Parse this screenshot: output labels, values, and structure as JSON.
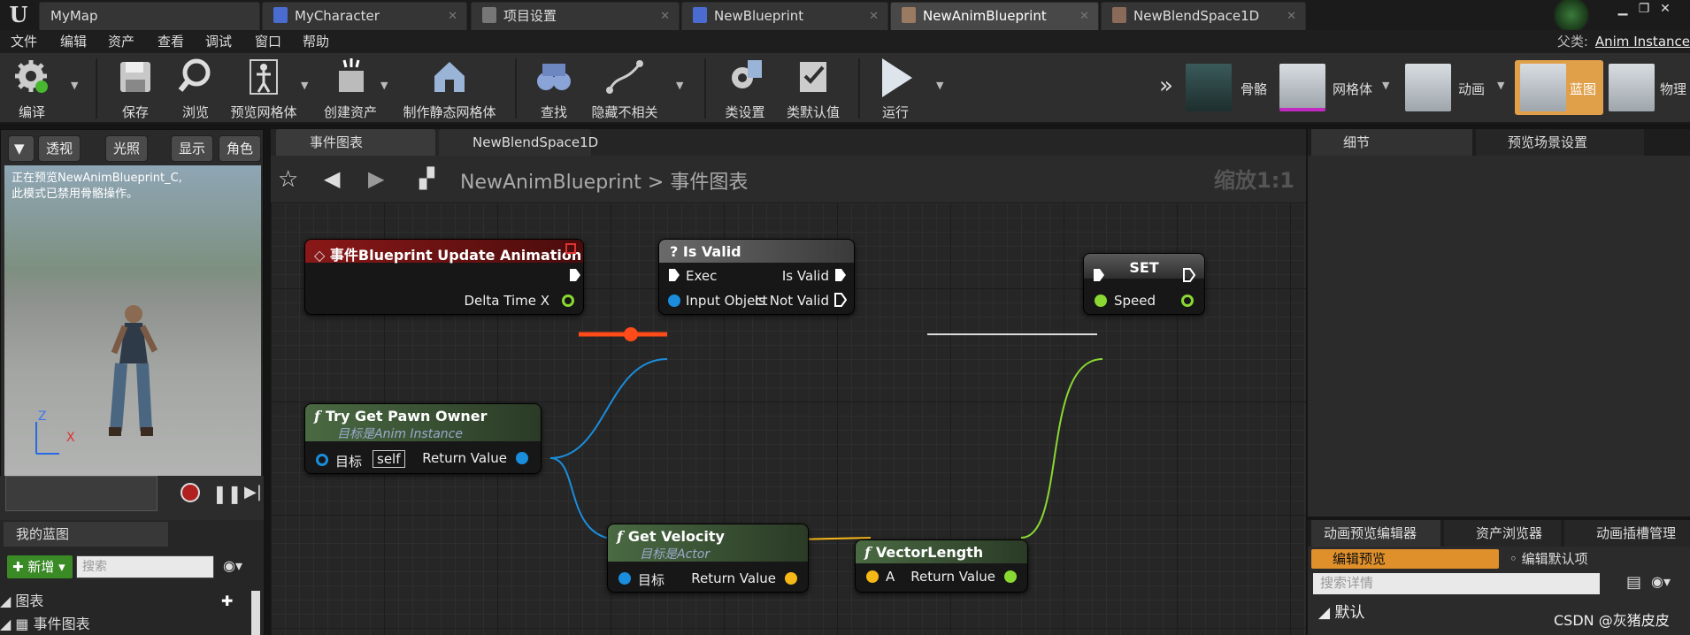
{
  "title_tabs": [
    {
      "label": "MyMap",
      "icon": "ue-logo-icon"
    },
    {
      "label": "MyCharacter",
      "icon": "blueprint-icon"
    },
    {
      "label": "项目设置",
      "icon": "gear-icon"
    },
    {
      "label": "NewBlueprint",
      "icon": "blueprint-icon"
    },
    {
      "label": "NewAnimBlueprint",
      "icon": "anim-blueprint-icon"
    },
    {
      "label": "NewBlendSpace1D",
      "icon": "blendspace-icon"
    }
  ],
  "active_tab": "NewAnimBlueprint",
  "menu": [
    "文件",
    "编辑",
    "资产",
    "查看",
    "调试",
    "窗口",
    "帮助"
  ],
  "parent_class": {
    "label": "父类:",
    "value": "Anim Instance"
  },
  "toolbar": {
    "compile": "编译",
    "save": "保存",
    "browse": "浏览",
    "preview_mesh": "预览网格体",
    "create_asset": "创建资产",
    "make_static_mesh": "制作静态网格体",
    "find": "查找",
    "hide_unrelated": "隐藏不相关",
    "class_settings": "类设置",
    "class_defaults": "类默认值",
    "play": "运行"
  },
  "modes": {
    "skeleton": "骨骼",
    "mesh": "网格体",
    "animation": "动画",
    "blueprint": "蓝图",
    "physics": "物理"
  },
  "viewport": {
    "buttons": {
      "perspective": "透视",
      "lit": "光照",
      "show": "显示",
      "character": "角色"
    },
    "info_line1": "正在预览NewAnimBlueprint_C,",
    "info_line2": "此模式已禁用骨骼操作。",
    "axis_z": "Z",
    "axis_x": "X"
  },
  "my_blueprint": {
    "tab": "我的蓝图",
    "new_button": "新增",
    "search_placeholder": "搜索",
    "tree": [
      {
        "label": "图表",
        "expanded": true
      },
      {
        "label": "事件图表",
        "expanded": true
      }
    ]
  },
  "graph": {
    "tabs": [
      "事件图表",
      "NewBlendSpace1D"
    ],
    "breadcrumb_root": "NewAnimBlueprint",
    "breadcrumb_sep": ">",
    "breadcrumb_leaf": "事件图表",
    "zoom": "缩放1:1",
    "nodes": {
      "event": {
        "title": "事件Blueprint Update Animation",
        "pin_delta": "Delta Time X"
      },
      "isvalid": {
        "title": "Is Valid",
        "pin_exec": "Exec",
        "pin_input": "Input Object",
        "pin_valid": "Is Valid",
        "pin_notvalid": "Is Not Valid"
      },
      "set": {
        "title": "SET",
        "pin_speed": "Speed"
      },
      "pawn": {
        "title": "Try Get Pawn Owner",
        "subtitle_prefix": "目标是",
        "subtitle_target": "Anim Instance",
        "pin_target": "目标",
        "self_label": "self",
        "pin_return": "Return Value"
      },
      "velocity": {
        "title": "Get Velocity",
        "subtitle_prefix": "目标是",
        "subtitle_target": "Actor",
        "pin_target": "目标",
        "pin_return": "Return Value"
      },
      "vlen": {
        "title": "VectorLength",
        "pin_a": "A",
        "pin_return": "Return Value"
      }
    }
  },
  "right_panel": {
    "top_tabs": [
      "细节",
      "预览场景设置"
    ],
    "bottom_tabs": [
      "动画预览编辑器",
      "资产浏览器",
      "动画插槽管理"
    ],
    "edit_preview": "编辑预览",
    "edit_defaults": "编辑默认项",
    "search_placeholder": "搜索详情",
    "default_section": "默认"
  },
  "watermark": "CSDN @灰猪皮皮",
  "colors": {
    "exec_wire_active": "#ff4a1a",
    "object_pin": "#1a8ddc",
    "float_pin": "#8ad832",
    "vector_pin": "#f6b817",
    "function_header": "#3d5a36",
    "event_header": "#7d1515",
    "accent": "#e0902a"
  }
}
